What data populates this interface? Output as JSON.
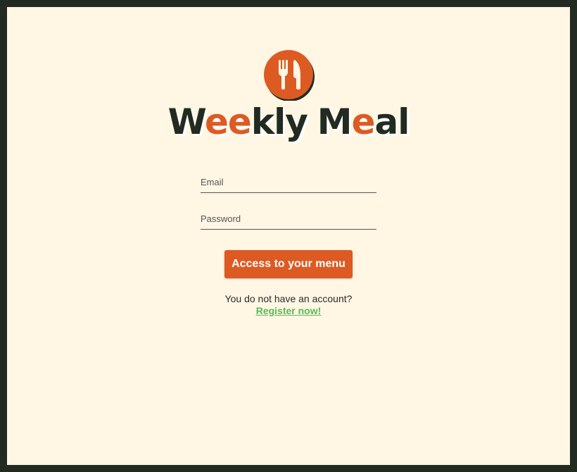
{
  "brand": {
    "title_parts": [
      "W",
      "ee",
      "kly",
      "M",
      "e",
      "al"
    ],
    "icon": "fork-knife-icon",
    "colors": {
      "accent": "#dd5a23",
      "dark": "#212b21",
      "background": "#fff6e4",
      "link": "#5cb85c"
    }
  },
  "login_form": {
    "email_placeholder": "Email",
    "password_placeholder": "Password",
    "submit_label": "Access to your menu"
  },
  "signup": {
    "prompt": "You do not have an account?",
    "link_label": "Register now!"
  }
}
